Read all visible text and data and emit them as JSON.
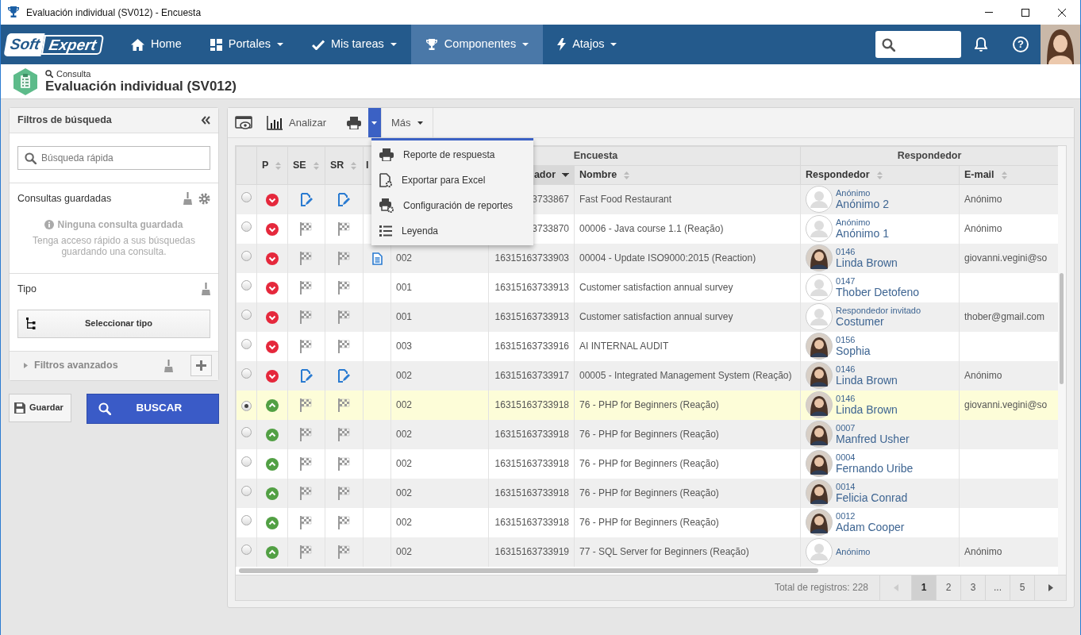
{
  "window": {
    "title": "Evaluación individual (SV012) - Encuesta"
  },
  "navbar": {
    "logo": [
      "Soft",
      "Expert"
    ],
    "help_label": "?",
    "items": [
      {
        "label": "Home",
        "kind": "home",
        "dropdown": false,
        "selected": false
      },
      {
        "label": "Portales",
        "kind": "grid",
        "dropdown": true,
        "selected": false
      },
      {
        "label": "Mis tareas",
        "kind": "check",
        "dropdown": true,
        "selected": false
      },
      {
        "label": "Componentes",
        "kind": "trophy",
        "dropdown": true,
        "selected": true
      },
      {
        "label": "Atajos",
        "kind": "bolt",
        "dropdown": true,
        "selected": false
      }
    ]
  },
  "header": {
    "breadcrumb": "Consulta",
    "title": "Evaluación individual (SV012)"
  },
  "filters": {
    "title": "Filtros de búsqueda",
    "search_placeholder": "Búsqueda rápida",
    "saved": {
      "title": "Consultas guardadas",
      "empty_title": "Ninguna consulta guardada",
      "empty_text": "Tenga acceso rápido a sus búsquedas guardando una consulta."
    },
    "type": {
      "title": "Tipo",
      "button": "Seleccionar tipo"
    },
    "advanced": {
      "label": "Filtros avanzados",
      "expanded": false
    }
  },
  "actions": {
    "save": "Guardar",
    "search": "BUSCAR"
  },
  "toolbar": {
    "analyze": "Analizar",
    "more": "Más",
    "print_menu": {
      "expanded": true,
      "items": [
        {
          "label": "Reporte de respuesta",
          "kind": "printer"
        },
        {
          "label": "Exportar para Excel",
          "kind": "export"
        },
        {
          "label": "Configuración de reportes",
          "kind": "settings"
        },
        {
          "label": "Leyenda",
          "kind": "legend"
        }
      ]
    }
  },
  "table": {
    "groups": [
      {
        "label": "Encuesta"
      },
      {
        "label": "Respondedor"
      }
    ],
    "columns": [
      {
        "label": "P",
        "sorted": false
      },
      {
        "label": "SE",
        "sorted": false
      },
      {
        "label": "SR",
        "sorted": false
      },
      {
        "label": "I"
      },
      {
        "label": "ador",
        "sorted": true
      },
      {
        "label": "Nombre",
        "sorted": false
      },
      {
        "label": "Respondedor",
        "sorted": false
      },
      {
        "label": "E-mail",
        "sorted": false
      }
    ],
    "rows": [
      {
        "selected": false,
        "p": {
          "kind": "down"
        },
        "se": {
          "kind": "edit"
        },
        "sr": {
          "kind": "edit"
        },
        "id": "3733867",
        "name": "Fast Food Restaurant",
        "respondent": {
          "code": "Anónimo",
          "name": "Anónimo 2",
          "avatar": {
            "kind": "blank"
          }
        },
        "email": "Anónimo"
      },
      {
        "selected": false,
        "p": {
          "kind": "down"
        },
        "se": {
          "kind": "flag"
        },
        "sr": {
          "kind": "flag"
        },
        "id": "3733870",
        "name": "00006 - Java course 1.1 (Reação)",
        "respondent": {
          "code": "Anónimo",
          "name": "Anónimo 1",
          "avatar": {
            "kind": "blank"
          }
        },
        "email": "Anónimo"
      },
      {
        "selected": false,
        "p": {
          "kind": "down"
        },
        "se": {
          "kind": "flag"
        },
        "sr": {
          "kind": "flag"
        },
        "i": {
          "kind": "document"
        },
        "code": "002",
        "id": "16315163733903",
        "name": "00004 - Update ISO9000:2015 (Reaction)",
        "respondent": {
          "code": "0146",
          "name": "Linda Brown",
          "avatar": {
            "kind": "photo"
          }
        },
        "email": "giovanni.vegini@so"
      },
      {
        "selected": false,
        "p": {
          "kind": "down"
        },
        "se": {
          "kind": "flag"
        },
        "sr": {
          "kind": "flag"
        },
        "code": "001",
        "id": "16315163733913",
        "name": "Customer satisfaction annual survey",
        "respondent": {
          "code": "0147",
          "name": "Thober Detofeno",
          "avatar": {
            "kind": "blank"
          }
        }
      },
      {
        "selected": false,
        "p": {
          "kind": "down"
        },
        "se": {
          "kind": "flag"
        },
        "sr": {
          "kind": "flag"
        },
        "code": "001",
        "id": "16315163733913",
        "name": "Customer satisfaction annual survey",
        "respondent": {
          "code": "Respondedor invitado",
          "name": "Costumer",
          "avatar": {
            "kind": "blank"
          }
        },
        "email": "thober@gmail.com"
      },
      {
        "selected": false,
        "p": {
          "kind": "down"
        },
        "se": {
          "kind": "flag"
        },
        "sr": {
          "kind": "flag"
        },
        "code": "003",
        "id": "16315163733916",
        "name": "AI INTERNAL AUDIT",
        "respondent": {
          "code": "0156",
          "name": "Sophia",
          "avatar": {
            "kind": "photo"
          }
        }
      },
      {
        "selected": false,
        "p": {
          "kind": "down"
        },
        "se": {
          "kind": "edit"
        },
        "sr": {
          "kind": "edit"
        },
        "code": "002",
        "id": "16315163733917",
        "name": "00005 - Integrated Management System (Reação)",
        "respondent": {
          "code": "0146",
          "name": "Linda Brown",
          "avatar": {
            "kind": "photo"
          }
        },
        "email": "Anónimo"
      },
      {
        "selected": true,
        "p": {
          "kind": "up"
        },
        "se": {
          "kind": "flag"
        },
        "sr": {
          "kind": "flag"
        },
        "code": "002",
        "id": "16315163733918",
        "name": "76 - PHP for Beginners (Reação)",
        "respondent": {
          "code": "0146",
          "name": "Linda Brown",
          "avatar": {
            "kind": "photo"
          }
        },
        "email": "giovanni.vegini@so"
      },
      {
        "selected": false,
        "p": {
          "kind": "up"
        },
        "se": {
          "kind": "flag"
        },
        "sr": {
          "kind": "flag"
        },
        "code": "002",
        "id": "16315163733918",
        "name": "76 - PHP for Beginners (Reação)",
        "respondent": {
          "code": "0007",
          "name": "Manfred Usher",
          "avatar": {
            "kind": "photo"
          }
        }
      },
      {
        "selected": false,
        "p": {
          "kind": "up"
        },
        "se": {
          "kind": "flag"
        },
        "sr": {
          "kind": "flag"
        },
        "code": "002",
        "id": "16315163733918",
        "name": "76 - PHP for Beginners (Reação)",
        "respondent": {
          "code": "0004",
          "name": "Fernando Uribe",
          "avatar": {
            "kind": "photo"
          }
        }
      },
      {
        "selected": false,
        "p": {
          "kind": "up"
        },
        "se": {
          "kind": "flag"
        },
        "sr": {
          "kind": "flag"
        },
        "code": "002",
        "id": "16315163733918",
        "name": "76 - PHP for Beginners (Reação)",
        "respondent": {
          "code": "0014",
          "name": "Felicia Conrad",
          "avatar": {
            "kind": "photo"
          }
        }
      },
      {
        "selected": false,
        "p": {
          "kind": "up"
        },
        "se": {
          "kind": "flag"
        },
        "sr": {
          "kind": "flag"
        },
        "code": "002",
        "id": "16315163733918",
        "name": "76 - PHP for Beginners (Reação)",
        "respondent": {
          "code": "0012",
          "name": "Adam Cooper",
          "avatar": {
            "kind": "photo"
          }
        }
      },
      {
        "selected": false,
        "p": {
          "kind": "up"
        },
        "se": {
          "kind": "flag"
        },
        "sr": {
          "kind": "flag"
        },
        "code": "002",
        "id": "16315163733919",
        "name": "77 - SQL Server for Beginners (Reação)",
        "respondent": {
          "code": "Anónimo",
          "avatar": {
            "kind": "blank"
          }
        },
        "email": "Anónimo"
      }
    ]
  },
  "footer": {
    "total": "Total de registros: 228",
    "pages": [
      {
        "label": "1",
        "selected": true
      },
      {
        "label": "2",
        "selected": false
      },
      {
        "label": "3",
        "selected": false
      },
      {
        "label": "...",
        "selected": false
      },
      {
        "label": "5",
        "selected": false
      }
    ]
  }
}
